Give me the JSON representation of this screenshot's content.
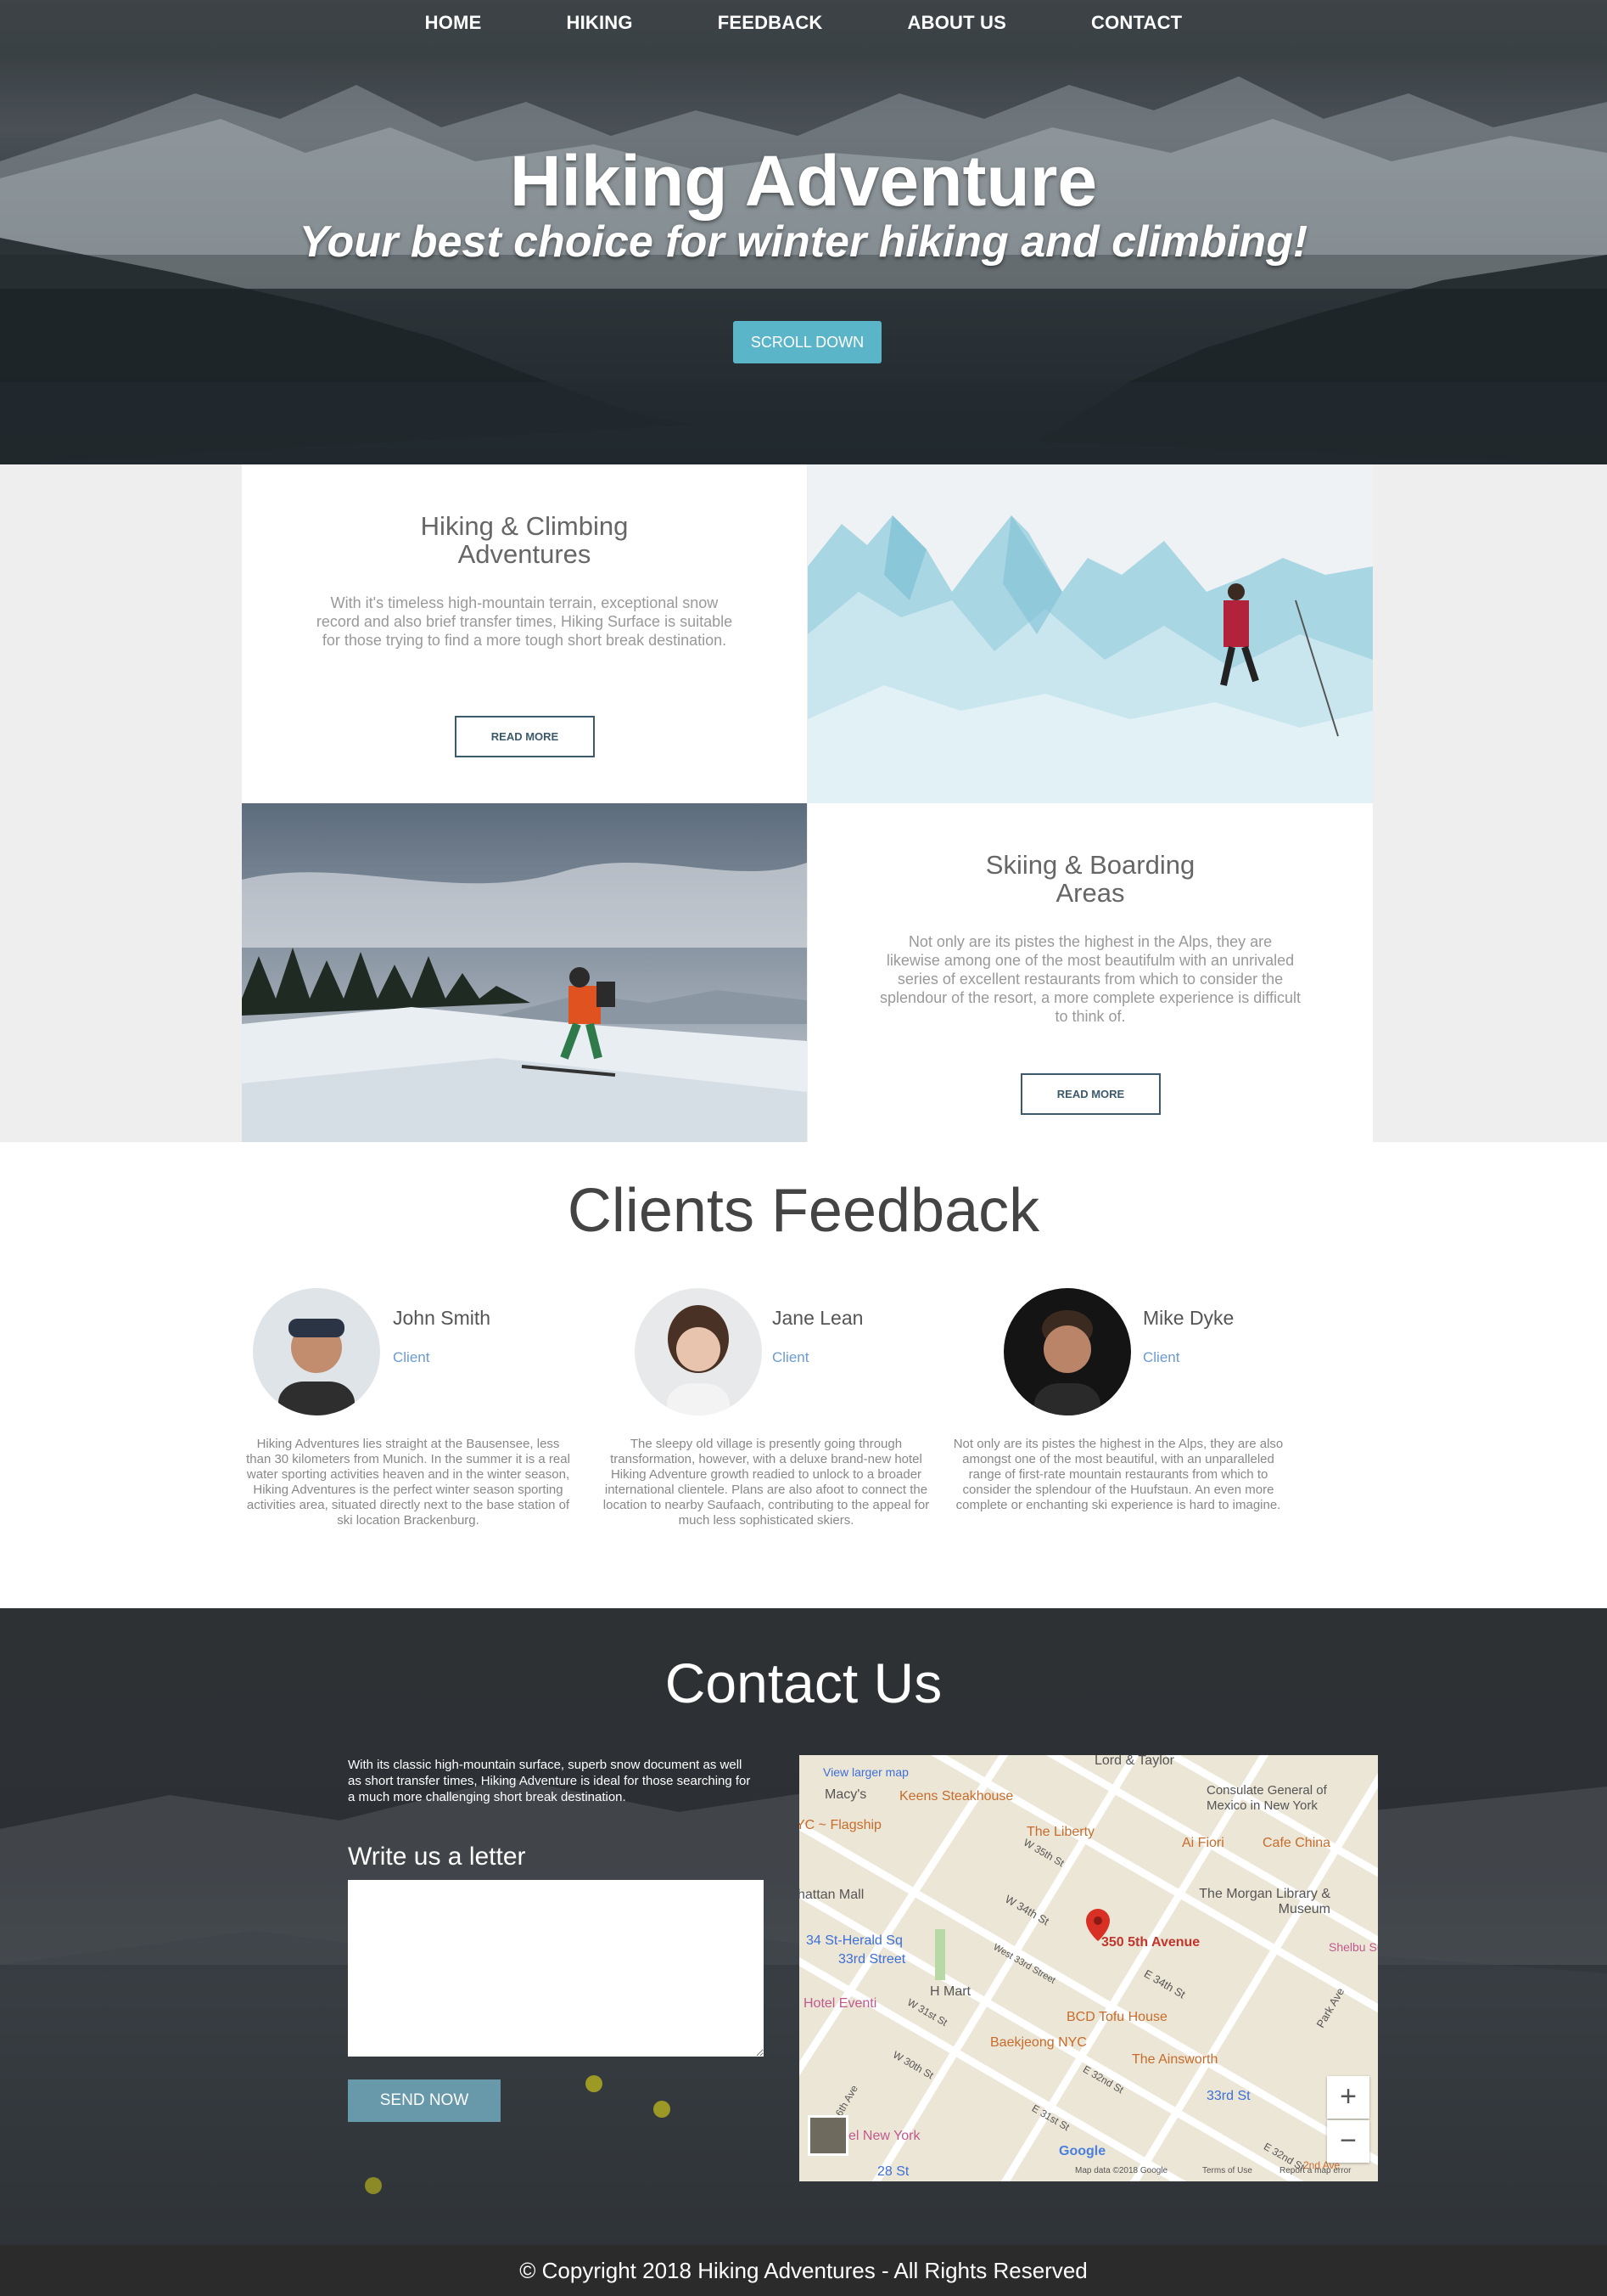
{
  "nav": {
    "items": [
      "HOME",
      "HIKING",
      "FEEDBACK",
      "ABOUT US",
      "CONTACT"
    ]
  },
  "hero": {
    "title": "Hiking Adventure",
    "subtitle": "Your best choice for winter hiking and climbing!",
    "button": "SCROLL DOWN"
  },
  "features": {
    "hiking": {
      "title": "Hiking & Climbing Adventures",
      "text": "With it's timeless high-mountain terrain, exceptional snow record and also brief transfer times, Hiking Surface is suitable for those trying to find a more tough short break destination.",
      "button": "READ MORE"
    },
    "skiing": {
      "title": "Skiing & Boarding Areas",
      "text": "Not only are its pistes the highest in the Alps, they are likewise among one of the most beautifulm with an unrivaled series of excellent restaurants from which to consider the splendour of the resort, a more complete experience is difficult to think of.",
      "button": "READ MORE"
    }
  },
  "feedback": {
    "title": "Clients Feedback",
    "clients": [
      {
        "name": "John Smith",
        "role": "Client",
        "text": "Hiking Adventures lies straight at the Bausensee, less than 30 kilometers from Munich. In the summer it is a real water sporting activities heaven and in the winter season, Hiking Adventures is the perfect winter season sporting activities area, situated directly next to the base station of ski location Brackenburg."
      },
      {
        "name": "Jane Lean",
        "role": "Client",
        "text": "The sleepy old village is presently going through transformation, however, with a deluxe brand-new hotel Hiking Adventure growth readied to unlock to a broader international clientele. Plans are also afoot to connect the location to nearby Saufaach, contributing to the appeal for much less sophisticated skiers."
      },
      {
        "name": "Mike Dyke",
        "role": "Client",
        "text": "Not only are its pistes the highest in the Alps, they are also amongst one of the most beautiful, with an unparalleled range of first-rate mountain restaurants from which to consider the splendour of the Huufstaun. An even more complete or enchanting ski experience is hard to imagine."
      }
    ]
  },
  "contact": {
    "title": "Contact Us",
    "description": "With its classic high-mountain surface, superb snow document as well as short transfer times, Hiking Adventure is ideal for those searching for a much more challenging short break destination.",
    "form_label": "Write us a letter",
    "button": "SEND NOW",
    "map": {
      "link": "View larger map",
      "address": "350 5th Avenue",
      "labels": [
        "Lord & Taylor",
        "Macy's",
        "Keens Steakhouse",
        "Consulate General of Mexico in New York",
        "YC ~ Flagship",
        "The Liberty",
        "Ai Fiori",
        "Cafe China",
        "W 35th St",
        "hattan Mall",
        "W 34th St",
        "The Morgan Library & Museum",
        "34 St-Herald Sq",
        "33rd Street",
        "West 33rd Street",
        "E 34th St",
        "Shelbu Suites",
        "H Mart",
        "Hotel Eventi",
        "W 31st St",
        "BCD Tofu House",
        "Park Ave",
        "Baekjeong NYC",
        "The Ainsworth",
        "W 30th St",
        "E 32nd St",
        "33rd St",
        "6th Ave",
        "E 31st St",
        "el New York",
        "28 St",
        "E 32nd St",
        "2nd Ave",
        "Google",
        "Map data ©2018 Google",
        "Terms of Use",
        "Report a map error"
      ],
      "zoom_in": "+",
      "zoom_out": "−"
    }
  },
  "footer": {
    "text": "© Copyright 2018 Hiking Adventures - All Rights Reserved"
  },
  "colors": {
    "accent": "#5bb5c9",
    "button_outline": "#3d5a6c",
    "send_button": "#6899aa",
    "role_text": "#6b9bd1"
  }
}
